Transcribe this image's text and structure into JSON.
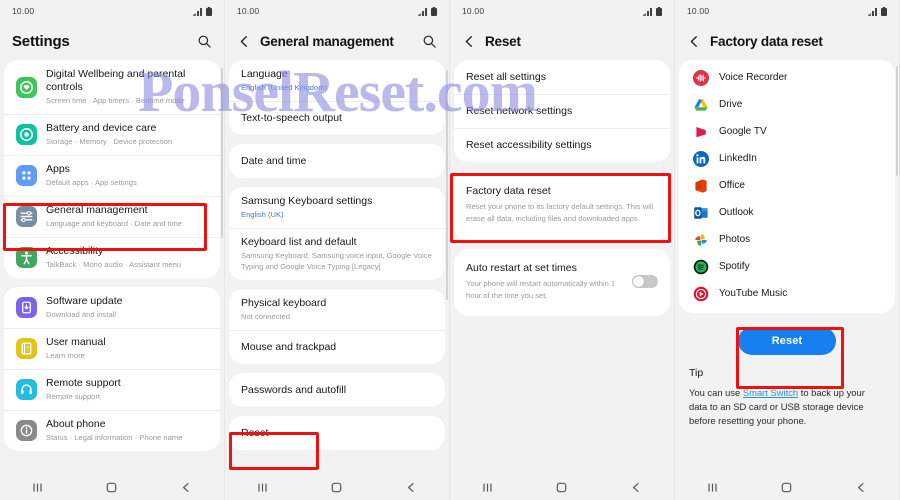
{
  "watermark": {
    "text": "PonselReset.com",
    "color": "#8f8fe0"
  },
  "status_bar": {
    "time": "10.00",
    "signal_icon": "signal-bars-icon",
    "battery_icon": "battery-icon"
  },
  "nav_bar": {
    "recents_icon": "recents-icon",
    "home_icon": "home-icon",
    "back_icon": "back-icon"
  },
  "colors": {
    "highlight": "#ef1010",
    "accent_button": "#1680f0",
    "link": "#2f8ee0",
    "subtitle_blue": "#3b7ae0"
  },
  "panel1": {
    "title": "Settings",
    "search_icon": "search-icon",
    "groups": [
      {
        "rows": [
          {
            "icon": "digital-wellbeing-icon",
            "icon_color": "#3ec65a",
            "title": "Digital Wellbeing and parental controls",
            "subtitle": "Screen time  ·  App timers  ·  Bedtime mode"
          },
          {
            "icon": "battery-device-care-icon",
            "icon_color": "#10c1a0",
            "title": "Battery and device care",
            "subtitle": "Storage  ·  Memory  ·  Device protection"
          },
          {
            "icon": "apps-icon",
            "icon_color": "#5e9cf5",
            "title": "Apps",
            "subtitle": "Default apps  ·  App settings"
          },
          {
            "icon": "general-management-icon",
            "icon_color": "#7a8da3",
            "title": "General management",
            "subtitle": "Language and keyboard  ·  Date and time"
          },
          {
            "icon": "accessibility-icon",
            "icon_color": "#3ea85f",
            "title": "Accessibility",
            "subtitle": "TalkBack  ·  Mono audio  ·  Assistant menu"
          }
        ]
      },
      {
        "rows": [
          {
            "icon": "software-update-icon",
            "icon_color": "#7a63e8",
            "title": "Software update",
            "subtitle": "Download and install"
          },
          {
            "icon": "user-manual-icon",
            "icon_color": "#e0c418",
            "title": "User manual",
            "subtitle": "Learn more"
          },
          {
            "icon": "remote-support-icon",
            "icon_color": "#23bde0",
            "title": "Remote support",
            "subtitle": "Remote support"
          },
          {
            "icon": "about-phone-icon",
            "icon_color": "#8a8a8a",
            "title": "About phone",
            "subtitle": "Status  ·  Legal information  ·  Phone name"
          }
        ]
      }
    ],
    "highlighted_row": "General management"
  },
  "panel2": {
    "title": "General management",
    "back_icon": "back-icon",
    "search_icon": "search-icon",
    "groups": [
      {
        "rows": [
          {
            "title": "Language",
            "subtitle": "English (United Kingdom)",
            "subtitle_style": "blue"
          },
          {
            "title": "Text-to-speech output",
            "subtitle": ""
          }
        ]
      },
      {
        "rows": [
          {
            "title": "Date and time",
            "subtitle": ""
          }
        ]
      },
      {
        "rows": [
          {
            "title": "Samsung Keyboard settings",
            "subtitle": "English (UK)",
            "subtitle_style": "blue"
          },
          {
            "title": "Keyboard list and default",
            "subtitle": "Samsung Keyboard, Samsung voice input, Google Voice Typing and Google Voice Typing [Legacy]"
          }
        ]
      },
      {
        "rows": [
          {
            "title": "Physical keyboard",
            "subtitle": "Not connected"
          },
          {
            "title": "Mouse and trackpad",
            "subtitle": ""
          }
        ]
      },
      {
        "rows": [
          {
            "title": "Passwords and autofill",
            "subtitle": ""
          }
        ]
      },
      {
        "rows": [
          {
            "title": "Reset",
            "subtitle": ""
          }
        ]
      }
    ],
    "highlighted_row": "Reset"
  },
  "panel3": {
    "title": "Reset",
    "back_icon": "back-icon",
    "groups": [
      {
        "rows": [
          {
            "title": "Reset all settings",
            "subtitle": ""
          },
          {
            "title": "Reset network settings",
            "subtitle": ""
          },
          {
            "title": "Reset accessibility settings",
            "subtitle": ""
          }
        ]
      },
      {
        "rows": [
          {
            "title": "Factory data reset",
            "subtitle": "Reset your phone to its factory default settings. This will erase all data, including files and downloaded apps."
          }
        ]
      },
      {
        "rows": [
          {
            "title": "Auto restart at set times",
            "subtitle": "Your phone will restart automatically within 1 hour of the time you set.",
            "toggle": "off"
          }
        ]
      }
    ],
    "highlighted_row": "Factory data reset"
  },
  "panel4": {
    "title": "Factory data reset",
    "back_icon": "back-icon",
    "apps": [
      {
        "name": "Voice Recorder",
        "icon": "voice-recorder-icon"
      },
      {
        "name": "Drive",
        "icon": "google-drive-icon"
      },
      {
        "name": "Google TV",
        "icon": "google-tv-icon"
      },
      {
        "name": "LinkedIn",
        "icon": "linkedin-icon"
      },
      {
        "name": "Office",
        "icon": "microsoft-office-icon"
      },
      {
        "name": "Outlook",
        "icon": "microsoft-outlook-icon"
      },
      {
        "name": "Photos",
        "icon": "google-photos-icon"
      },
      {
        "name": "Spotify",
        "icon": "spotify-icon"
      },
      {
        "name": "YouTube Music",
        "icon": "youtube-music-icon"
      }
    ],
    "reset_button": "Reset",
    "tip": {
      "heading": "Tip",
      "text_before": "You can use ",
      "link": "Smart Switch",
      "text_after": " to back up your data to an SD card or USB storage device before resetting your phone."
    }
  }
}
